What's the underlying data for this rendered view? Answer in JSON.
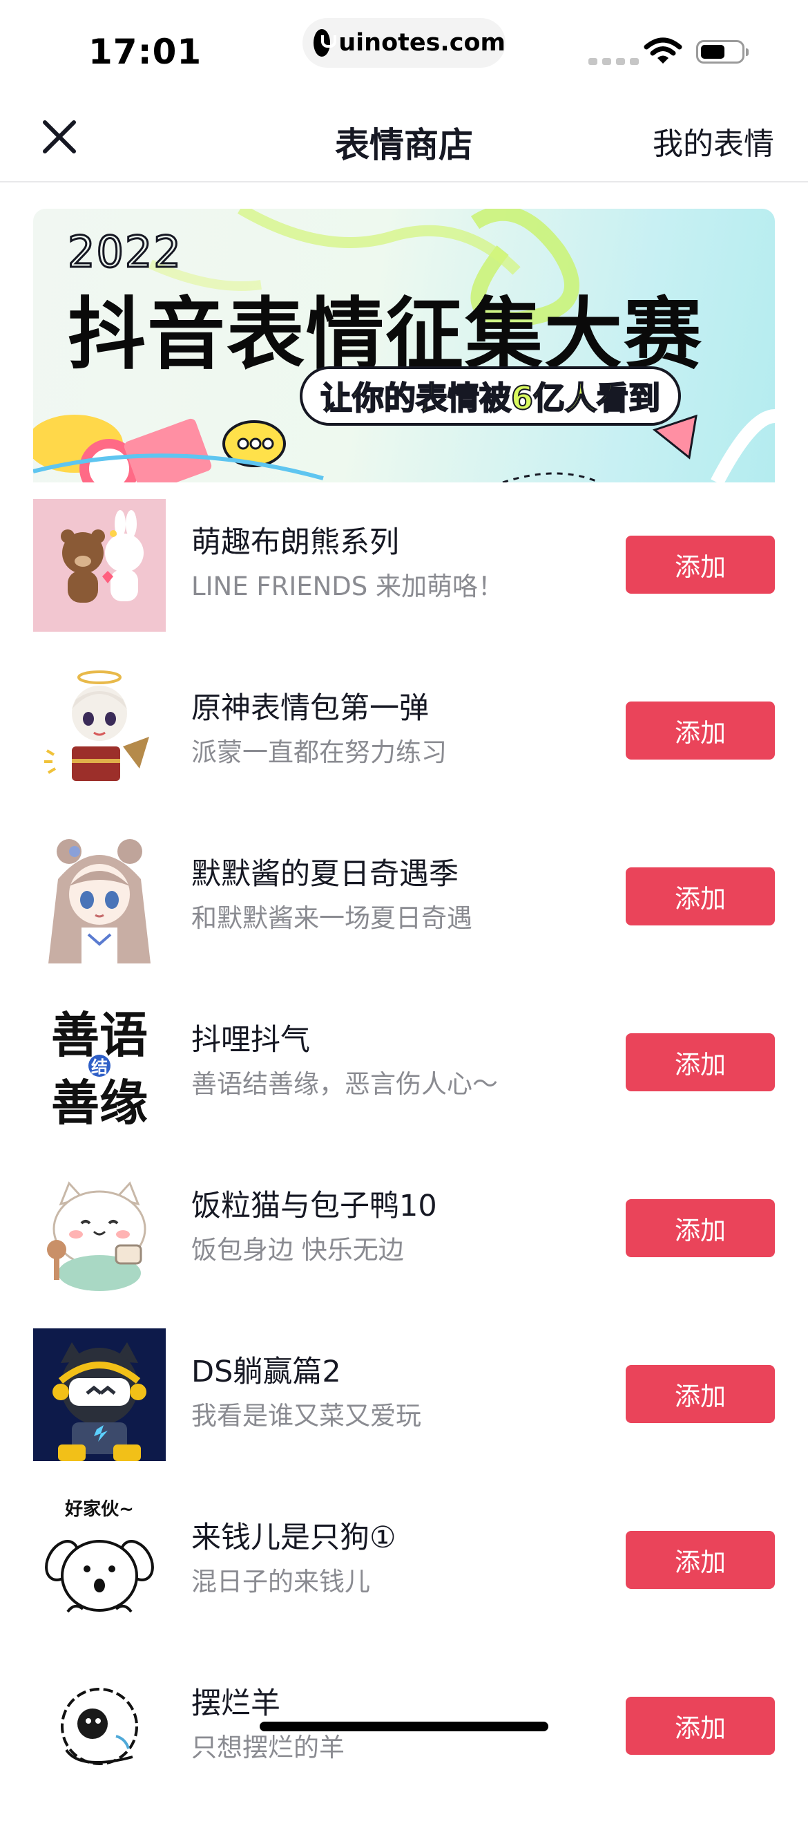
{
  "status_bar": {
    "time": "17:01",
    "url": "uinotes.com"
  },
  "nav": {
    "title": "表情商店",
    "right_link": "我的表情",
    "close_icon": "close-icon"
  },
  "banner": {
    "year": "2022",
    "title": "抖音表情征集大赛",
    "subtitle": "让你的表情被6亿人看到"
  },
  "colors": {
    "accent": "#ea445a",
    "title_text": "#161823",
    "secondary_text": "#8a8b91",
    "divider": "#e8e8ea"
  },
  "stickers": [
    {
      "name": "萌趣布朗熊系列",
      "desc": "LINE FRIENDS 来加萌咯！",
      "button": "添加",
      "icon": "brown-bear-cony-icon"
    },
    {
      "name": "原神表情包第一弹",
      "desc": "派蒙一直都在努力练习",
      "button": "添加",
      "icon": "paimon-icon"
    },
    {
      "name": "默默酱的夏日奇遇季",
      "desc": "和默默酱来一场夏日奇遇",
      "button": "添加",
      "icon": "anime-girl-icon"
    },
    {
      "name": "抖哩抖气",
      "desc": "善语结善缘，恶言伤人心～",
      "button": "添加",
      "icon": "calligraphy-text-icon",
      "thumb_text": [
        "善语",
        "结",
        "善缘"
      ]
    },
    {
      "name": "饭粒猫与包子鸭10",
      "desc": "饭包身边 快乐无边",
      "button": "添加",
      "icon": "cat-icon"
    },
    {
      "name": "DS躺赢篇2",
      "desc": "我看是谁又菜又爱玩",
      "button": "添加",
      "icon": "gamer-dog-icon"
    },
    {
      "name": "来钱儿是只狗①",
      "desc": "混日子的来钱儿",
      "button": "添加",
      "icon": "dog-icon",
      "thumb_text": [
        "好家伙~"
      ]
    },
    {
      "name": "摆烂羊",
      "desc": "只想摆烂的羊",
      "button": "添加",
      "icon": "sheep-icon"
    }
  ]
}
